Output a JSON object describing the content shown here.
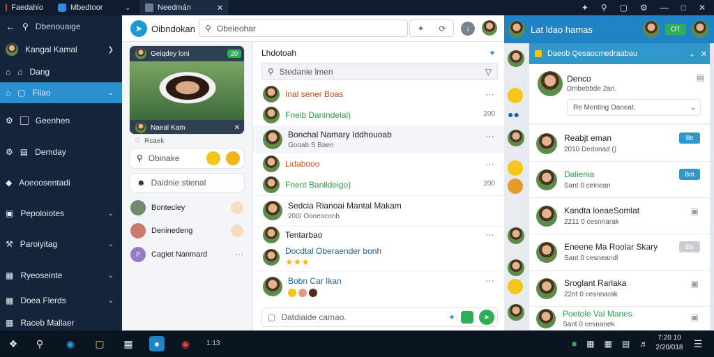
{
  "titlebar": {
    "tabs": [
      "Faedahio",
      "Mbedtoor",
      "Needmán"
    ],
    "controls": [
      "pin-icon",
      "search-icon",
      "chat-icon",
      "settings-icon",
      "minimize-icon",
      "maximize-icon",
      "close-icon"
    ]
  },
  "sidebar": {
    "search_label": "Dbenouaige",
    "profile_name": "Kangal Kamal",
    "items": [
      {
        "label": "Dang"
      },
      {
        "label": "Fiiao"
      },
      {
        "label": "Geenhen"
      },
      {
        "label": "Demday"
      },
      {
        "label": "Aoeoosentadi"
      },
      {
        "label": "Pepoloiotes"
      },
      {
        "label": "Paroiyitag"
      },
      {
        "label": "Ryeoseinte"
      },
      {
        "label": "Doea Flerds"
      },
      {
        "label": "Raceb Mallaer"
      }
    ]
  },
  "app": {
    "title": "Oibndokan",
    "search_placeholder": "Obeleohar",
    "profile_card": {
      "header_name": "Geiqdey loni",
      "header_badge": "20",
      "footer_name": "Naeal Kam",
      "footer_sub": "Rsaek"
    },
    "search_box": "Obinake",
    "search_box2": "Daidnie stienal",
    "contacts": [
      {
        "name": "Bontecley"
      },
      {
        "name": "Deninedeng"
      },
      {
        "name": "Cagiet Nanmard"
      }
    ],
    "feed": {
      "title": "Lhdotoah",
      "search_placeholder": "Stedanie lmen",
      "items": [
        {
          "name": "Inal sener Boas",
          "sub": "Fneib Danindelai)",
          "time": "200"
        },
        {
          "name": "Bonchal Namary Iddhouoab",
          "sub": "Gooab S Baen",
          "time": ""
        },
        {
          "name": "Lidabooo",
          "sub": "Fnent Banlldeigo)",
          "time": "200"
        },
        {
          "name": "Sedcia Rianoai Mantal Makam",
          "sub": "200/ Ooneoconb",
          "time": ""
        },
        {
          "name": "Tentarbao",
          "sub": "Docdtal Oberaender bonh",
          "time": ""
        },
        {
          "name": "Bobn Car Ikan",
          "sub": "",
          "time": ""
        }
      ],
      "compose_placeholder": "Datdiaide camao."
    }
  },
  "rpanel": {
    "title": "Lat ldao hamas",
    "badge": "OT",
    "subheader": "Daeob Qesaocmedraabau",
    "top_name": "Denco",
    "top_sub": "Dmbebbde 2an.",
    "top_select": "Re Menting Oaneat.",
    "people": [
      {
        "name": "Reabjt eman",
        "sub": "2010 Dedonad ()",
        "pill": "Blt",
        "pill_color": "#2f97c9"
      },
      {
        "name": "Dalienia",
        "sub": "Sant 0 cirinean",
        "pill": "Bdt",
        "pill_color": "#2f97c9"
      },
      {
        "name": "Kandta loeaeSomlat",
        "sub": "2211 0 cesnnarak",
        "pill": "",
        "pill_color": ""
      },
      {
        "name": "Eneene Ma Roolar Skary",
        "sub": "Sant 0 cesneandl",
        "pill": "Bo",
        "pill_color": "#c9cdd3"
      },
      {
        "name": "Sroglant Rarlaka",
        "sub": "22nt 0 cesnnarak",
        "pill": "",
        "pill_color": ""
      },
      {
        "name": "Poetole Val Manes",
        "sub": "Sant 0 cesnanek",
        "pill": "",
        "pill_color": ""
      }
    ]
  },
  "taskbar": {
    "label": "1:13",
    "time": "7:20 10",
    "date": "2/20/018"
  }
}
